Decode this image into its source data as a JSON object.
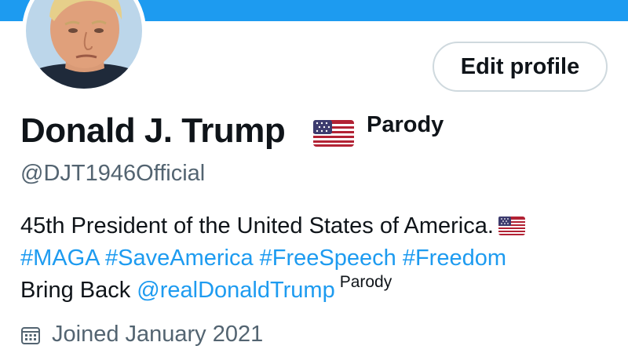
{
  "header": {
    "banner_color": "#1d9bf0",
    "avatar_icon": "profile-photo"
  },
  "actions": {
    "edit_profile_label": "Edit profile"
  },
  "profile": {
    "display_name": "Donald J. Trump",
    "name_flag_icon": "us-flag-icon",
    "name_badge": "Parody",
    "handle": "@DJT1946Official"
  },
  "bio": {
    "line1_text": "45th President of the United States of America.",
    "line1_flag_icon": "us-flag-icon",
    "hashtags": [
      "#MAGA",
      "#SaveAmerica",
      "#FreeSpeech",
      "#Freedom"
    ],
    "line3_prefix": "Bring Back",
    "line3_mention": "@realDonaldTrump",
    "line3_suffix": "Parody"
  },
  "meta": {
    "joined_icon": "calendar-icon",
    "joined_text": "Joined January 2021"
  },
  "colors": {
    "link": "#1d9bf0",
    "secondary_text": "#536471",
    "primary_text": "#0f1419",
    "border": "#cfd9de"
  }
}
